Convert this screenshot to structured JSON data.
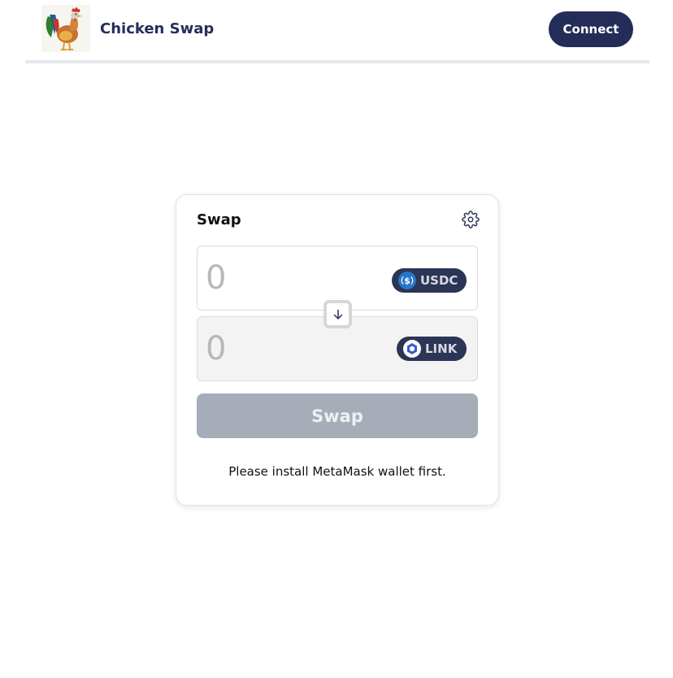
{
  "header": {
    "brand_name": "Chicken Swap",
    "logo_icon": "rooster-logo",
    "connect_label": "Connect"
  },
  "swap_card": {
    "title": "Swap",
    "settings_icon": "gear-icon",
    "from": {
      "placeholder": "0",
      "value": "",
      "token_symbol": "USDC",
      "token_icon": "usdc-icon"
    },
    "to": {
      "placeholder": "0",
      "value": "",
      "token_symbol": "LINK",
      "token_icon": "chainlink-icon"
    },
    "switch_icon": "arrow-down-icon",
    "swap_button_label": "Swap",
    "swap_button_disabled": true,
    "notice": "Please install MetaMask wallet first."
  },
  "colors": {
    "primary": "#242d57",
    "token_pill": "#2b3555",
    "disabled_button": "#a7adb8",
    "usdc_blue": "#2775ca",
    "link_blue": "#375bd2"
  }
}
